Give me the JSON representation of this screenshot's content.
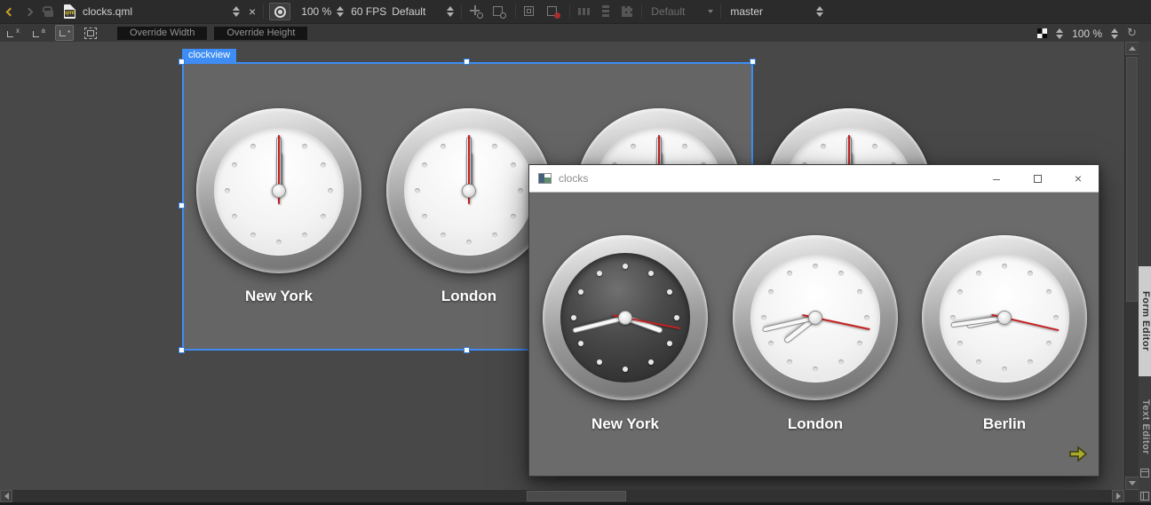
{
  "toolbar_top": {
    "document_name": "clocks.qml",
    "preview_zoom": "100 %",
    "fps": "60 FPS",
    "fps_profile": "Default",
    "style": "Default",
    "branch": "master"
  },
  "toolbar_canvas": {
    "override_width": "Override Width",
    "override_height": "Override Height",
    "canvas_zoom": "100 %"
  },
  "glyphs": {
    "close_document": "×",
    "reset_zoom": "↺",
    "window_minimize": "–",
    "window_close": "×",
    "snap_none": "x",
    "snap_anchor": "a",
    "snap_parent": "▪"
  },
  "form_editor": {
    "selection_label": "clockview",
    "selection_color": "#3d8df5",
    "clocks": [
      {
        "label": "New York",
        "face": "light",
        "hour_deg": 0,
        "minute_deg": 0,
        "second_deg": 0
      },
      {
        "label": "London",
        "face": "light",
        "hour_deg": 0,
        "minute_deg": 0,
        "second_deg": 0
      },
      {
        "label": "",
        "face": "light",
        "hour_deg": 0,
        "minute_deg": 0,
        "second_deg": 0
      },
      {
        "label": "",
        "face": "light",
        "hour_deg": 0,
        "minute_deg": 0,
        "second_deg": 0
      }
    ]
  },
  "app_window": {
    "title": "clocks",
    "clocks": [
      {
        "label": "New York",
        "face": "dark",
        "hour_deg": 110,
        "minute_deg": 256,
        "second_deg": 101
      },
      {
        "label": "London",
        "face": "light",
        "hour_deg": 232,
        "minute_deg": 257,
        "second_deg": 102
      },
      {
        "label": "Berlin",
        "face": "light",
        "hour_deg": 258,
        "minute_deg": 262,
        "second_deg": 103
      }
    ],
    "second_hand_color": "#c62222",
    "next_arrow_color": "#a9a92c"
  },
  "side_tabs": [
    {
      "label": "Form Editor",
      "active": true
    },
    {
      "label": "Text Editor",
      "active": false
    }
  ]
}
